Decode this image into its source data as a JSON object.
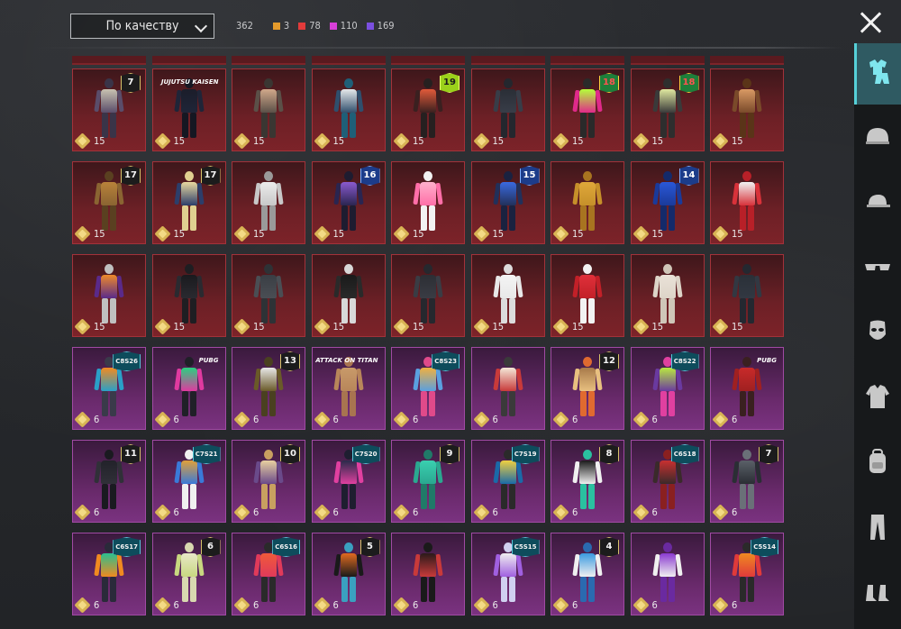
{
  "toolbar": {
    "sort_label": "По качеству"
  },
  "counters": {
    "total": "362",
    "items": [
      {
        "value": "3",
        "color": "#e59b2c"
      },
      {
        "value": "78",
        "color": "#e23b3b"
      },
      {
        "value": "110",
        "color": "#d83fd8"
      },
      {
        "value": "169",
        "color": "#7b4fe0"
      }
    ]
  },
  "rows": [
    {
      "tier": "red",
      "cells": [
        {
          "badge": "7",
          "badge_style": "gold",
          "cost": "15",
          "colors": [
            "#c8c2b0",
            "#5a4d6a",
            "#3a3448"
          ]
        },
        {
          "badge": "JUJUTSU KAISEN",
          "badge_style": "txt",
          "cost": "15",
          "colors": [
            "#1b1d2a",
            "#1f2538",
            "#151722"
          ]
        },
        {
          "badge": "",
          "badge_style": "",
          "cost": "15",
          "colors": [
            "#d1a88a",
            "#5b5048",
            "#3a3632"
          ]
        },
        {
          "badge": "",
          "badge_style": "",
          "cost": "15",
          "colors": [
            "#e5e8ea",
            "#2f4f6d",
            "#1f5f78"
          ]
        },
        {
          "badge": "19",
          "badge_style": "green",
          "cost": "15",
          "colors": [
            "#e05a3a",
            "#3a2020",
            "#262020"
          ]
        },
        {
          "badge": "",
          "badge_style": "",
          "cost": "15",
          "colors": [
            "#2a2e36",
            "#383d48",
            "#24272e"
          ]
        },
        {
          "badge": "18",
          "badge_style": "redb",
          "cost": "15",
          "colors": [
            "#b4ff3a",
            "#e02a8a",
            "#2a2a2a"
          ]
        },
        {
          "badge": "18",
          "badge_style": "redb",
          "cost": "15",
          "colors": [
            "#dfe8a0",
            "#3a3a3a",
            "#2e2e2e"
          ]
        },
        {
          "badge": "",
          "badge_style": "",
          "cost": "15",
          "colors": [
            "#d99a64",
            "#7a4a2a",
            "#5a3418"
          ]
        }
      ]
    },
    {
      "tier": "red",
      "cells": [
        {
          "badge": "17",
          "badge_style": "gold",
          "cost": "15",
          "colors": [
            "#b9823a",
            "#8a6432",
            "#5a4020"
          ]
        },
        {
          "badge": "17",
          "badge_style": "gold",
          "cost": "15",
          "colors": [
            "#e8d8a0",
            "#2c3e6a",
            "#e0d090"
          ]
        },
        {
          "badge": "",
          "badge_style": "",
          "cost": "15",
          "colors": [
            "#ececec",
            "#c8c8c8",
            "#9a9a9a"
          ]
        },
        {
          "badge": "16",
          "badge_style": "blue",
          "cost": "15",
          "colors": [
            "#8a5acf",
            "#2a2550",
            "#1e1c30"
          ]
        },
        {
          "badge": "",
          "badge_style": "",
          "cost": "15",
          "colors": [
            "#ffb0cc",
            "#ff6fa8",
            "#f2f2f2"
          ]
        },
        {
          "badge": "15",
          "badge_style": "blue",
          "cost": "15",
          "colors": [
            "#3a6ae0",
            "#22305a",
            "#1a2240"
          ]
        },
        {
          "badge": "",
          "badge_style": "",
          "cost": "15",
          "colors": [
            "#e0a83a",
            "#c6902a",
            "#a87420"
          ]
        },
        {
          "badge": "14",
          "badge_style": "blue",
          "cost": "15",
          "colors": [
            "#2a58d8",
            "#1a3a9a",
            "#142a6a"
          ]
        },
        {
          "badge": "",
          "badge_style": "",
          "cost": "15",
          "colors": [
            "#f2f2f2",
            "#d8323a",
            "#b82028"
          ]
        }
      ]
    },
    {
      "tier": "red",
      "cells": [
        {
          "badge": "",
          "badge_style": "",
          "cost": "15",
          "colors": [
            "#ee8a2a",
            "#5a2a8a",
            "#c0c0c0"
          ]
        },
        {
          "badge": "",
          "badge_style": "",
          "cost": "15",
          "colors": [
            "#1a1a1e",
            "#2a2a30",
            "#1e1e22"
          ]
        },
        {
          "badge": "",
          "badge_style": "",
          "cost": "15",
          "colors": [
            "#3a3e44",
            "#4a4e54",
            "#2e3236"
          ]
        },
        {
          "badge": "",
          "badge_style": "",
          "cost": "15",
          "colors": [
            "#1a1a1a",
            "#2a2a2a",
            "#d8d8d8"
          ]
        },
        {
          "badge": "",
          "badge_style": "",
          "cost": "15",
          "colors": [
            "#2c2e34",
            "#3a3c44",
            "#26282e"
          ]
        },
        {
          "badge": "",
          "badge_style": "",
          "cost": "15",
          "colors": [
            "#f4f4f4",
            "#e8e8e8",
            "#dcdcdc"
          ]
        },
        {
          "badge": "",
          "badge_style": "",
          "cost": "15",
          "colors": [
            "#e0303a",
            "#c22028",
            "#f2f2f2"
          ]
        },
        {
          "badge": "",
          "badge_style": "",
          "cost": "15",
          "colors": [
            "#eae2d8",
            "#ddd4c8",
            "#cfc6b8"
          ]
        },
        {
          "badge": "",
          "badge_style": "",
          "cost": "15",
          "colors": [
            "#2a3038",
            "#323842",
            "#242830"
          ]
        }
      ]
    },
    {
      "tier": "purple",
      "cells": [
        {
          "badge": "C8S26",
          "badge_style": "cs",
          "cost": "6",
          "colors": [
            "#f28a20",
            "#2aa0c8",
            "#3a3a4a"
          ]
        },
        {
          "badge": "PUBG",
          "badge_style": "txt",
          "cost": "6",
          "colors": [
            "#2ad080",
            "#e03aa0",
            "#202028"
          ]
        },
        {
          "badge": "13",
          "badge_style": "gold",
          "cost": "6",
          "colors": [
            "#e8e8e8",
            "#6a5a28",
            "#4a4020"
          ]
        },
        {
          "badge": "ATTACK ON TITAN",
          "badge_style": "txt",
          "cost": "6",
          "colors": [
            "#c89a6a",
            "#b8865a",
            "#a87450"
          ]
        },
        {
          "badge": "C8S23",
          "badge_style": "cs",
          "cost": "6",
          "colors": [
            "#f0b040",
            "#5aa0e0",
            "#e04a8a"
          ]
        },
        {
          "badge": "",
          "badge_style": "",
          "cost": "6",
          "colors": [
            "#f4e8d8",
            "#c83a3a",
            "#3a3a3a"
          ]
        },
        {
          "badge": "12",
          "badge_style": "gold",
          "cost": "6",
          "colors": [
            "#a87a4a",
            "#e8c080",
            "#e06a30"
          ]
        },
        {
          "badge": "C8S22",
          "badge_style": "cs",
          "cost": "6",
          "colors": [
            "#b8e840",
            "#6a3aa0",
            "#e040a0"
          ]
        },
        {
          "badge": "PUBG",
          "badge_style": "txt",
          "cost": "6",
          "colors": [
            "#c82a2a",
            "#a02020",
            "#3a2020"
          ]
        }
      ]
    },
    {
      "tier": "purple",
      "cells": [
        {
          "badge": "11",
          "badge_style": "gold",
          "cost": "6",
          "colors": [
            "#22222a",
            "#303038",
            "#1a1a20"
          ]
        },
        {
          "badge": "C7S21",
          "badge_style": "cs",
          "cost": "6",
          "colors": [
            "#e0a03a",
            "#3a7ad8",
            "#f0f0f0"
          ]
        },
        {
          "badge": "10",
          "badge_style": "gold",
          "cost": "6",
          "colors": [
            "#e8d0a0",
            "#6a4a8a",
            "#c8a060"
          ]
        },
        {
          "badge": "C7S20",
          "badge_style": "cs",
          "cost": "6",
          "colors": [
            "#2a2a4a",
            "#e040a0",
            "#1e1e30"
          ]
        },
        {
          "badge": "9",
          "badge_style": "gold",
          "cost": "6",
          "colors": [
            "#3ad0b0",
            "#2aa890",
            "#207a68"
          ]
        },
        {
          "badge": "C7S19",
          "badge_style": "cs",
          "cost": "6",
          "colors": [
            "#f0d040",
            "#1a6aa8",
            "#2a2a2a"
          ]
        },
        {
          "badge": "8",
          "badge_style": "gold",
          "cost": "6",
          "colors": [
            "#1a1a1a",
            "#f0f0f0",
            "#2ac0a0"
          ]
        },
        {
          "badge": "C6S18",
          "badge_style": "cs",
          "cost": "6",
          "colors": [
            "#c83030",
            "#3a2a2a",
            "#8a2020"
          ]
        },
        {
          "badge": "7",
          "badge_style": "gold",
          "cost": "6",
          "colors": [
            "#5a6068",
            "#2a2e34",
            "#6a7078"
          ]
        }
      ]
    },
    {
      "tier": "purple",
      "cells": [
        {
          "badge": "C6S17",
          "badge_style": "cs",
          "cost": "6",
          "colors": [
            "#2ac090",
            "#f08a20",
            "#2a2a3a"
          ]
        },
        {
          "badge": "6",
          "badge_style": "gold",
          "cost": "6",
          "colors": [
            "#e8e8c8",
            "#c8d880",
            "#d8d8b0"
          ]
        },
        {
          "badge": "C6S16",
          "badge_style": "cs",
          "cost": "6",
          "colors": [
            "#f05a3a",
            "#e03a5a",
            "#2a2a2a"
          ]
        },
        {
          "badge": "5",
          "badge_style": "gold",
          "cost": "6",
          "colors": [
            "#e06a20",
            "#1a1a1a",
            "#3aa0c0"
          ]
        },
        {
          "badge": "",
          "badge_style": "",
          "cost": "6",
          "colors": [
            "#2a1a1a",
            "#c83a3a",
            "#1a1a1a"
          ]
        },
        {
          "badge": "C5S15",
          "badge_style": "cs",
          "cost": "6",
          "colors": [
            "#f0f0f0",
            "#a060e0",
            "#d0d0f0"
          ]
        },
        {
          "badge": "4",
          "badge_style": "gold",
          "cost": "6",
          "colors": [
            "#3a9ae0",
            "#f0f0f0",
            "#2a6ab0"
          ]
        },
        {
          "badge": "",
          "badge_style": "",
          "cost": "6",
          "colors": [
            "#8a3ad0",
            "#f0f0f0",
            "#6a2aa0"
          ]
        },
        {
          "badge": "C5S14",
          "badge_style": "cs",
          "cost": "6",
          "colors": [
            "#f08a20",
            "#e03a3a",
            "#2a2a2a"
          ]
        }
      ]
    }
  ],
  "sidebar": {
    "items": [
      {
        "icon": "outfit-icon",
        "active": true
      },
      {
        "icon": "helmet-icon",
        "active": false
      },
      {
        "icon": "cap-icon",
        "active": false
      },
      {
        "icon": "glasses-icon",
        "active": false
      },
      {
        "icon": "mask-icon",
        "active": false
      },
      {
        "icon": "shirt-icon",
        "active": false
      },
      {
        "icon": "backpack-icon",
        "active": false
      },
      {
        "icon": "pants-icon",
        "active": false
      },
      {
        "icon": "shoes-icon",
        "active": false
      }
    ]
  }
}
